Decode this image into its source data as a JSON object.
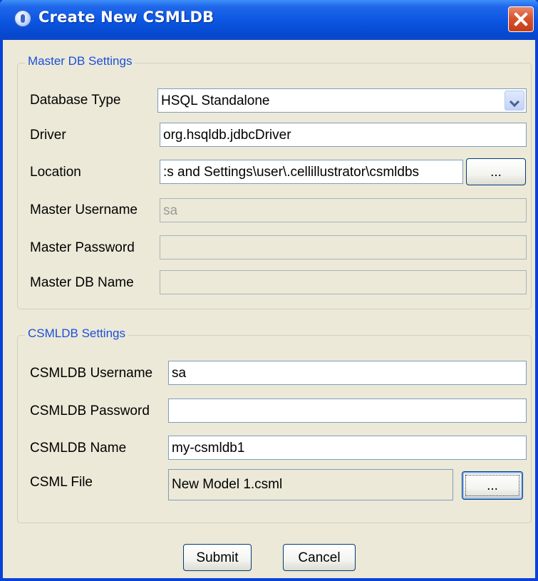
{
  "window": {
    "title": "Create New CSMLDB"
  },
  "master": {
    "group_label": "Master DB Settings",
    "database_type_label": "Database Type",
    "database_type_value": "HSQL Standalone",
    "driver_label": "Driver",
    "driver_value": "org.hsqldb.jdbcDriver",
    "location_label": "Location",
    "location_value": ":s and Settings\\user\\.cellillustrator\\csmldbs",
    "location_browse_label": "...",
    "username_label": "Master Username",
    "username_value": "sa",
    "password_label": "Master Password",
    "password_value": "",
    "dbname_label": "Master DB Name",
    "dbname_value": ""
  },
  "csmldb": {
    "group_label": "CSMLDB Settings",
    "username_label": "CSMLDB Username",
    "username_value": "sa",
    "password_label": "CSMLDB Password",
    "password_value": "",
    "name_label": "CSMLDB Name",
    "name_value": "my-csmldb1",
    "file_label": "CSML File",
    "file_value": "New Model 1.csml",
    "file_browse_label": "..."
  },
  "buttons": {
    "submit_label": "Submit",
    "cancel_label": "Cancel"
  },
  "icons": {
    "title": "app-icon",
    "close": "close-icon",
    "dropdown": "chevron-down-icon"
  }
}
